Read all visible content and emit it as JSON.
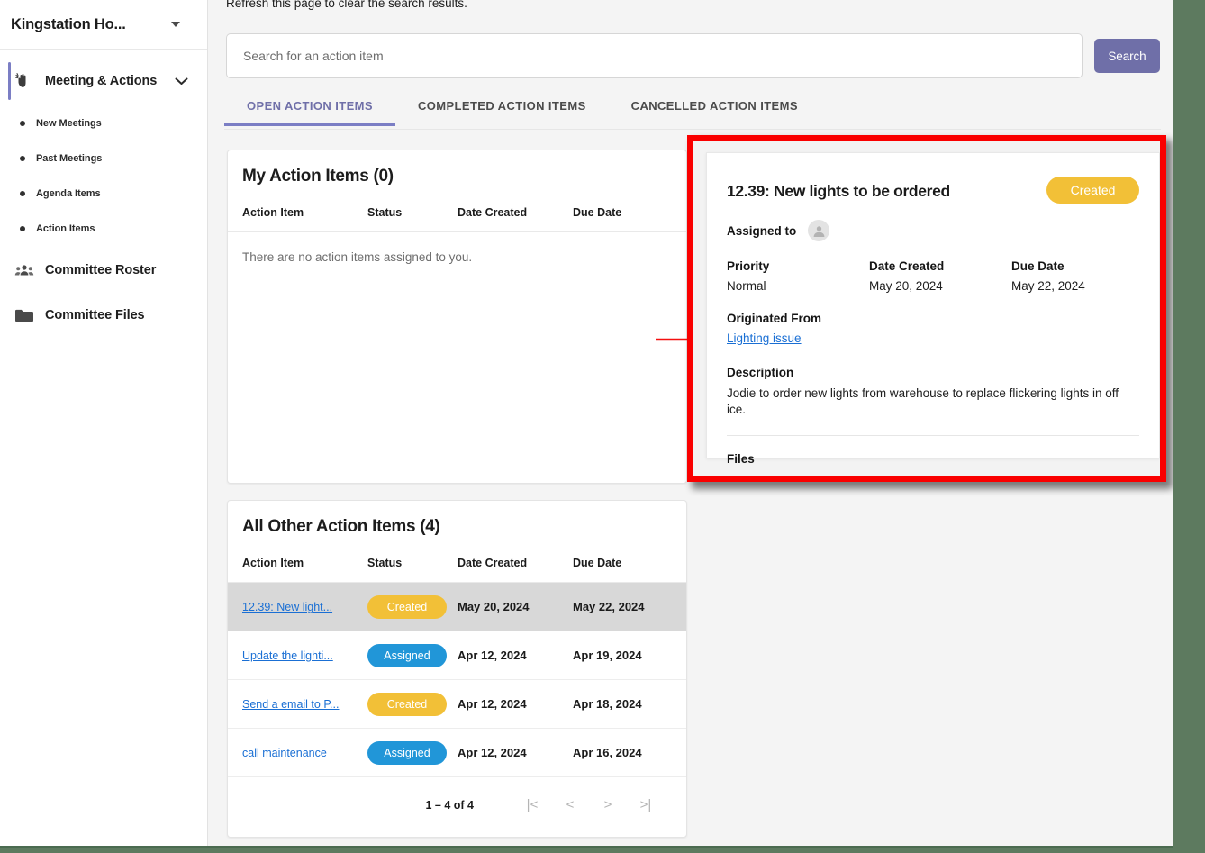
{
  "sidebar": {
    "org_title": "Kingstation Ho...",
    "org_caret_icon": "caret-down-icon",
    "primary": {
      "label": "Meeting & Actions",
      "icon": "hand-gesture-icon",
      "chevron_icon": "chevron-down-icon"
    },
    "sub_items": [
      {
        "label": "New Meetings"
      },
      {
        "label": "Past Meetings"
      },
      {
        "label": "Agenda Items"
      },
      {
        "label": "Action Items"
      }
    ],
    "secondary": [
      {
        "label": "Committee Roster",
        "icon": "people-group-icon"
      },
      {
        "label": "Committee Files",
        "icon": "folder-icon"
      }
    ]
  },
  "main": {
    "notice": "Refresh this page to clear the search results.",
    "search": {
      "placeholder": "Search for an action item",
      "value": "",
      "button_label": "Search"
    },
    "tabs": [
      {
        "label": "OPEN ACTION ITEMS",
        "active": true
      },
      {
        "label": "COMPLETED ACTION ITEMS",
        "active": false
      },
      {
        "label": "CANCELLED ACTION ITEMS",
        "active": false
      }
    ]
  },
  "my_action_items": {
    "title": "My Action Items (0)",
    "columns": [
      "Action Item",
      "Status",
      "Date Created",
      "Due Date"
    ],
    "empty_message": "There are no action items assigned to you.",
    "rows": []
  },
  "all_other_action_items": {
    "title": "All Other Action Items (4)",
    "columns": [
      "Action Item",
      "Status",
      "Date Created",
      "Due Date"
    ],
    "rows": [
      {
        "item": "12.39: New light...",
        "status": "Created",
        "status_color": "#f2c037",
        "date_created": "May 20, 2024",
        "due_date": "May 22, 2024",
        "selected": true
      },
      {
        "item": "Update the lighti...",
        "status": "Assigned",
        "status_color": "#2196d8",
        "date_created": "Apr 12, 2024",
        "due_date": "Apr 19, 2024",
        "selected": false
      },
      {
        "item": "Send a email to P...",
        "status": "Created",
        "status_color": "#f2c037",
        "date_created": "Apr 12, 2024",
        "due_date": "Apr 18, 2024",
        "selected": false
      },
      {
        "item": "call maintenance",
        "status": "Assigned",
        "status_color": "#2196d8",
        "date_created": "Apr 12, 2024",
        "due_date": "Apr 16, 2024",
        "selected": false
      }
    ],
    "pagination": {
      "range_label": "1 – 4 of 4",
      "first_icon": "|<",
      "prev_icon": "<",
      "next_icon": ">",
      "last_icon": ">|"
    }
  },
  "detail_panel": {
    "title": "12.39: New lights to be ordered",
    "status_badge": "Created",
    "status_color": "#f2c037",
    "assigned_to_label": "Assigned to",
    "assignee_avatar_icon": "person-avatar-icon",
    "priority_label": "Priority",
    "priority_value": "Normal",
    "date_created_label": "Date Created",
    "date_created_value": "May 20, 2024",
    "due_date_label": "Due Date",
    "due_date_value": "May 22, 2024",
    "originated_from_label": "Originated From",
    "originated_from_link": "Lighting issue",
    "description_label": "Description",
    "description_value": "Jodie to order new lights from warehouse to replace flickering lights in off ice.",
    "files_label": "Files",
    "highlight_color": "#fa0000"
  },
  "annotation": {
    "arrow_icon": "red-arrow-right",
    "arrow_color": "#f41010"
  },
  "theme": {
    "accent": "#6f6fa8",
    "link": "#1a6fd4",
    "page_bg": "#f4f4f4",
    "outer_bg": "#5d7a5f"
  }
}
